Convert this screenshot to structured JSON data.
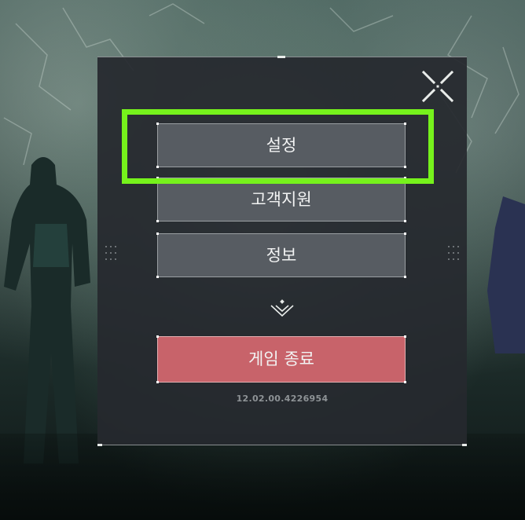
{
  "menu": {
    "settings_label": "설정",
    "support_label": "고객지원",
    "info_label": "정보",
    "quit_label": "게임 종료"
  },
  "version": "12.02.00.4226954",
  "icons": {
    "close": "close-x-icon",
    "more": "expand-more-icon"
  },
  "colors": {
    "panel_bg": "#26292e",
    "button_bg": "#575c62",
    "quit_bg": "#c8636a",
    "highlight": "#76f21c",
    "text": "#f2f3f3",
    "version_text": "#8e9396"
  }
}
